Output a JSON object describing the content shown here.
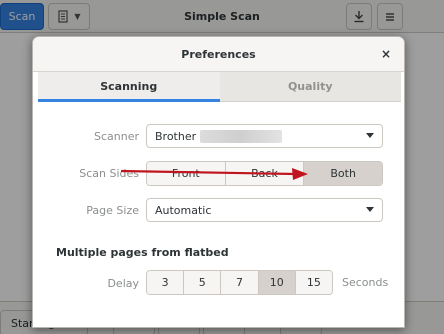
{
  "app": {
    "title": "Simple Scan",
    "scan_label": "Scan",
    "start_again_label": "Start again"
  },
  "dialog": {
    "title": "Preferences",
    "close_glyph": "×",
    "tabs": [
      {
        "label": "Scanning",
        "active": true
      },
      {
        "label": "Quality",
        "active": false
      }
    ],
    "scanner": {
      "label": "Scanner",
      "value": "Brother"
    },
    "scan_sides": {
      "label": "Scan Sides",
      "options": [
        "Front",
        "Back",
        "Both"
      ],
      "selected": "Both"
    },
    "page_size": {
      "label": "Page Size",
      "value": "Automatic"
    },
    "flatbed": {
      "section_title": "Multiple pages from flatbed",
      "delay_label": "Delay",
      "options": [
        "3",
        "5",
        "7",
        "10",
        "15"
      ],
      "selected": "10",
      "unit": "Seconds"
    }
  },
  "colors": {
    "accent": "#3584e4",
    "annotation_arrow": "#c0141e",
    "selected_toggle": "#d6d1cd"
  }
}
